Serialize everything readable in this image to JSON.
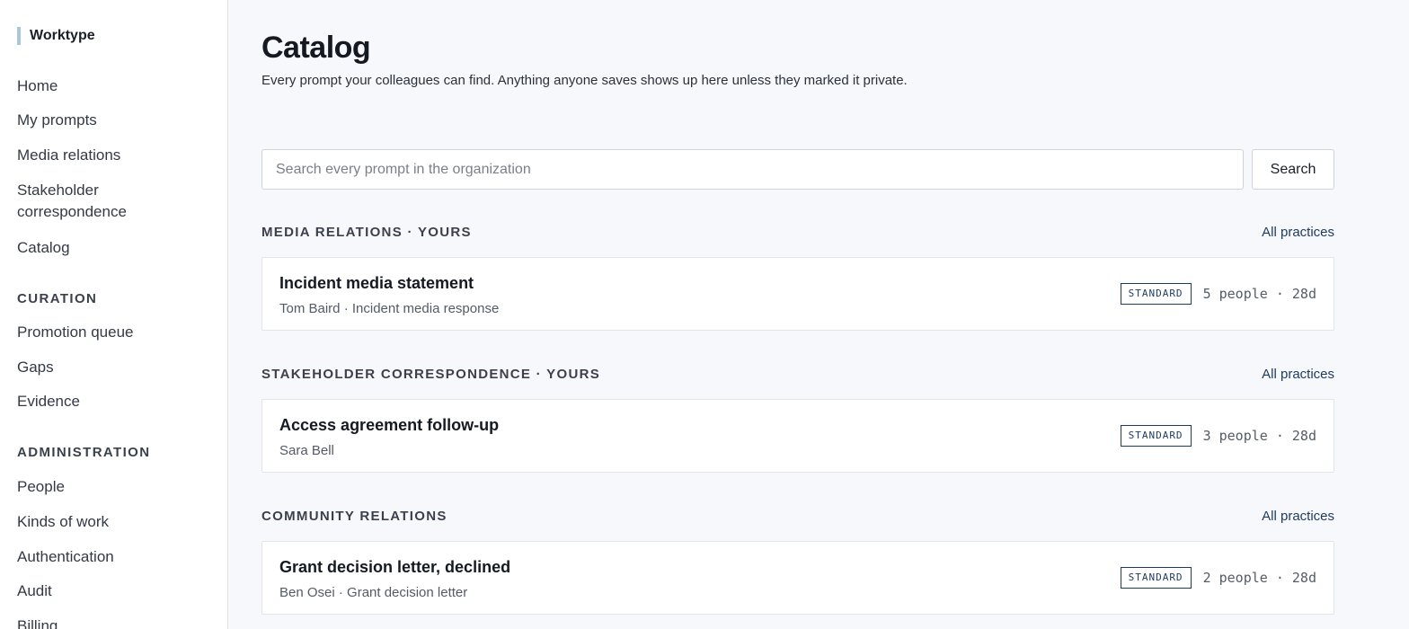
{
  "sidebar": {
    "brand": "Worktype",
    "nav_main": [
      "Home",
      "My prompts",
      "Media relations",
      "Stakeholder correspondence",
      "Catalog"
    ],
    "section_curation": "Curation",
    "nav_curation": [
      "Promotion queue",
      "Gaps",
      "Evidence"
    ],
    "section_admin": "Administration",
    "nav_admin": [
      "People",
      "Kinds of work",
      "Authentication",
      "Audit",
      "Billing"
    ]
  },
  "page": {
    "title": "Catalog",
    "subtitle": "Every prompt your colleagues can find. Anything anyone saves shows up here unless they marked it private."
  },
  "search": {
    "placeholder": "Search every prompt in the organization",
    "value": "",
    "button_label": "Search"
  },
  "sections": [
    {
      "title": "Media relations · yours",
      "link": "All practices",
      "card": {
        "title": "Incident media statement",
        "meta": "Tom Baird · Incident media response",
        "badge": "STANDARD",
        "stats": "5 people · 28d"
      }
    },
    {
      "title": "Stakeholder correspondence · yours",
      "link": "All practices",
      "card": {
        "title": "Access agreement follow-up",
        "meta": "Sara Bell",
        "badge": "STANDARD",
        "stats": "3 people · 28d"
      }
    },
    {
      "title": "Community relations",
      "link": "All practices",
      "card": {
        "title": "Grant decision letter, declined",
        "meta": "Ben Osei · Grant decision letter",
        "badge": "STANDARD",
        "stats": "2 people · 28d"
      }
    }
  ],
  "colors": {
    "accent": "#1d3a5f",
    "brand_bar": "#a9c7d8",
    "background": "#f7f8fb"
  }
}
